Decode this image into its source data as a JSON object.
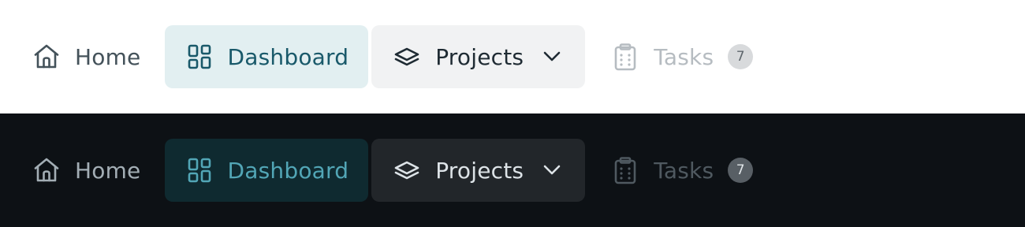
{
  "themes": [
    {
      "name": "light",
      "nav": {
        "items": [
          {
            "label": "Home",
            "icon": "home-icon",
            "state": "default"
          },
          {
            "label": "Dashboard",
            "icon": "dashboard-grid-icon",
            "state": "active"
          },
          {
            "label": "Projects",
            "icon": "layers-icon",
            "state": "open",
            "trailing_icon": "chevron-down-icon"
          },
          {
            "label": "Tasks",
            "icon": "clipboard-icon",
            "state": "disabled",
            "badge": "7"
          }
        ]
      },
      "colors": {
        "background": "#ffffff",
        "active_bg": "#e2eff1",
        "active_fg": "#19596a",
        "open_bg": "#f1f2f3"
      }
    },
    {
      "name": "dark",
      "nav": {
        "items": [
          {
            "label": "Home",
            "icon": "home-icon",
            "state": "default"
          },
          {
            "label": "Dashboard",
            "icon": "dashboard-grid-icon",
            "state": "active"
          },
          {
            "label": "Projects",
            "icon": "layers-icon",
            "state": "open",
            "trailing_icon": "chevron-down-icon"
          },
          {
            "label": "Tasks",
            "icon": "clipboard-icon",
            "state": "disabled",
            "badge": "7"
          }
        ]
      },
      "colors": {
        "background": "#0d1115",
        "active_bg": "#0f2a30",
        "active_fg": "#52a6b6",
        "open_bg": "#22262a"
      }
    }
  ]
}
